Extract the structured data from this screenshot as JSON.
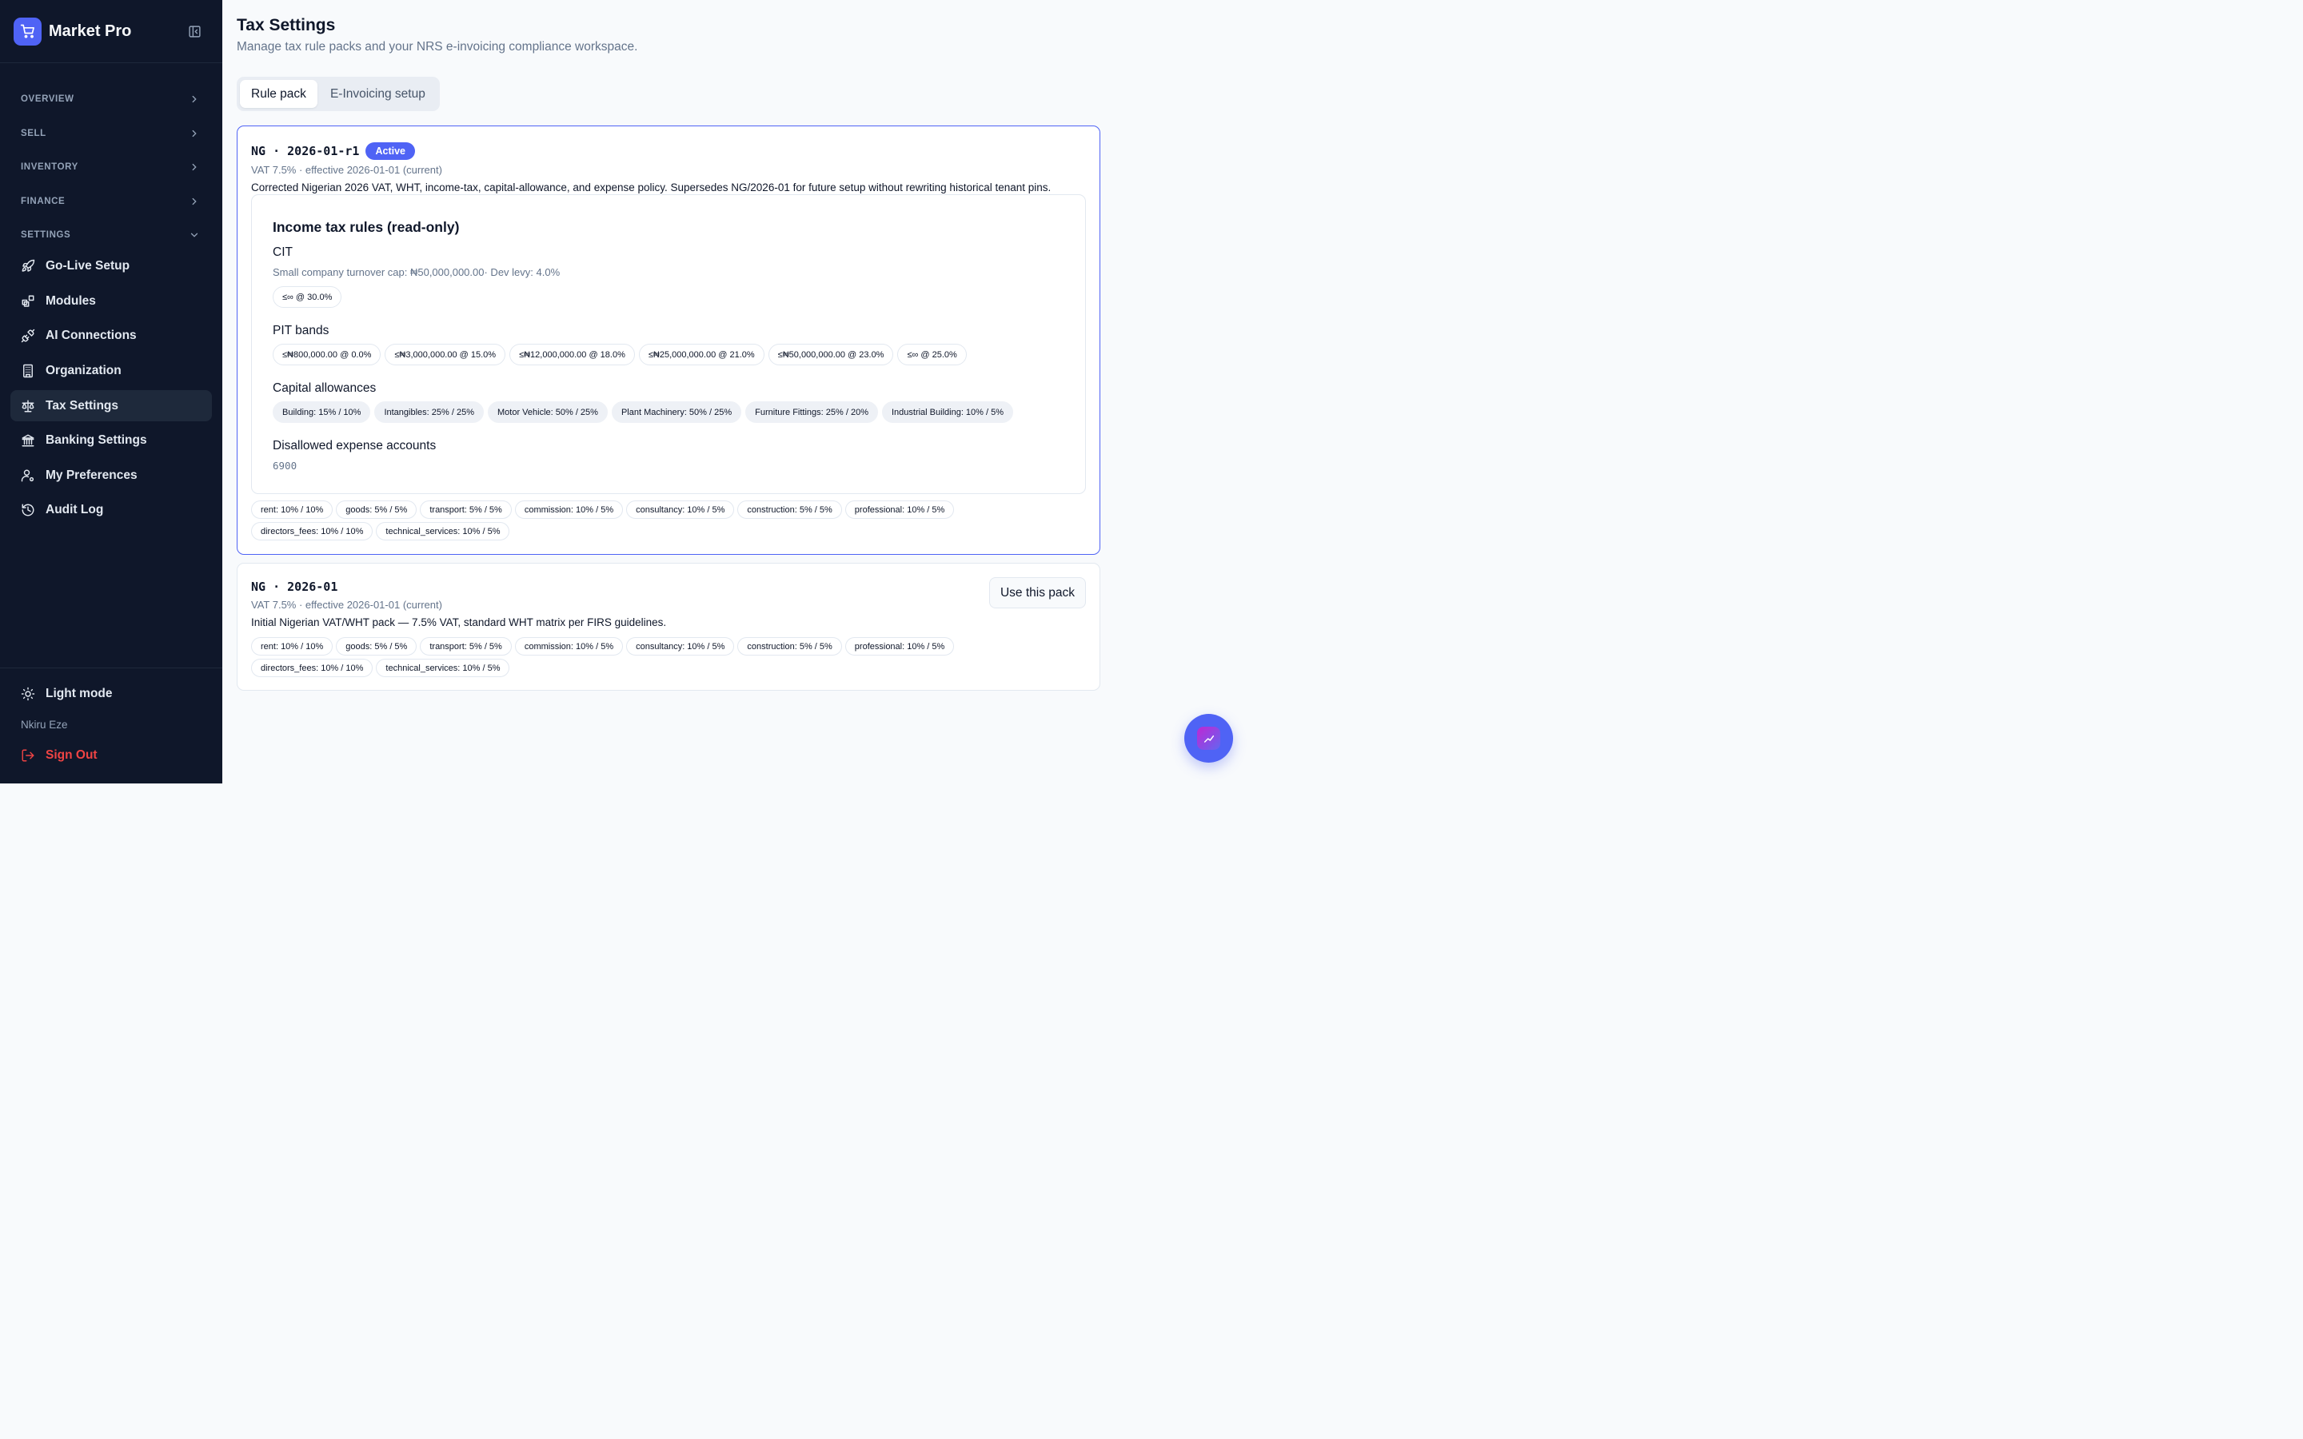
{
  "app": {
    "name": "Market Pro"
  },
  "sidebar": {
    "sections": [
      {
        "label": "OVERVIEW"
      },
      {
        "label": "SELL"
      },
      {
        "label": "INVENTORY"
      },
      {
        "label": "FINANCE"
      },
      {
        "label": "SETTINGS"
      }
    ],
    "items": [
      {
        "label": "Go-Live Setup",
        "icon": "rocket-icon"
      },
      {
        "label": "Modules",
        "icon": "modules-icon"
      },
      {
        "label": "AI Connections",
        "icon": "plug-icon"
      },
      {
        "label": "Organization",
        "icon": "building-icon"
      },
      {
        "label": "Tax Settings",
        "icon": "scale-icon",
        "active": true
      },
      {
        "label": "Banking Settings",
        "icon": "bank-icon"
      },
      {
        "label": "My Preferences",
        "icon": "user-settings-icon"
      },
      {
        "label": "Audit Log",
        "icon": "history-icon"
      }
    ],
    "footer": {
      "theme_toggle": "Light mode",
      "user_name": "Nkiru Eze",
      "sign_out": "Sign Out"
    }
  },
  "page": {
    "title": "Tax Settings",
    "subtitle": "Manage tax rule packs and your NRS e-invoicing compliance workspace."
  },
  "tabs": [
    {
      "label": "Rule pack",
      "active": true
    },
    {
      "label": "E-Invoicing setup",
      "active": false
    }
  ],
  "packs": [
    {
      "code": "NG · 2026-01-r1",
      "badge": "Active",
      "meta": "VAT 7.5% · effective 2026-01-01 (current)",
      "description": "Corrected Nigerian 2026 VAT, WHT, income-tax, capital-allowance, and expense policy. Supersedes NG/2026-01 for future setup without rewriting historical tenant pins.",
      "income_tax": {
        "title": "Income tax rules (read-only)",
        "cit": {
          "heading": "CIT",
          "meta": "Small company turnover cap: ₦50,000,000.00· Dev levy: 4.0%",
          "bands": [
            "≤∞ @ 30.0%"
          ]
        },
        "pit": {
          "heading": "PIT bands",
          "bands": [
            "≤₦800,000.00 @ 0.0%",
            "≤₦3,000,000.00 @ 15.0%",
            "≤₦12,000,000.00 @ 18.0%",
            "≤₦25,000,000.00 @ 21.0%",
            "≤₦50,000,000.00 @ 23.0%",
            "≤∞ @ 25.0%"
          ]
        },
        "capital_allowances": {
          "heading": "Capital allowances",
          "items": [
            "Building: 15% / 10%",
            "Intangibles: 25% / 25%",
            "Motor Vehicle: 50% / 25%",
            "Plant Machinery: 50% / 25%",
            "Furniture Fittings: 25% / 20%",
            "Industrial Building: 10% / 5%"
          ]
        },
        "disallowed": {
          "heading": "Disallowed expense accounts",
          "value": "6900"
        }
      },
      "wht_row1": [
        "rent: 10% / 10%",
        "goods: 5% / 5%",
        "transport: 5% / 5%",
        "commission: 10% / 5%",
        "consultancy: 10% / 5%",
        "construction: 5% / 5%",
        "professional: 10% / 5%"
      ],
      "wht_row2": [
        "directors_fees: 10% / 10%",
        "technical_services: 10% / 5%"
      ]
    },
    {
      "code": "NG · 2026-01",
      "meta": "VAT 7.5% · effective 2026-01-01 (current)",
      "description": "Initial Nigerian VAT/WHT pack — 7.5% VAT, standard WHT matrix per FIRS guidelines.",
      "action": "Use this pack",
      "wht_row1": [
        "rent: 10% / 10%",
        "goods: 5% / 5%",
        "transport: 5% / 5%",
        "commission: 10% / 5%",
        "consultancy: 10% / 5%",
        "construction: 5% / 5%",
        "professional: 10% / 5%"
      ],
      "wht_row2": [
        "directors_fees: 10% / 10%",
        "technical_services: 10% / 5%"
      ]
    }
  ],
  "colors": {
    "sidebar_bg": "#0f172a",
    "accent": "#4f63f5",
    "sign_out": "#ef4444"
  }
}
